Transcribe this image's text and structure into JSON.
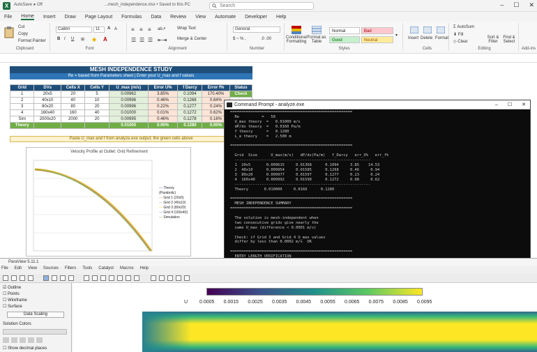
{
  "excel": {
    "title": "...mesh_independence.xlsx • Saved to this PC",
    "search_placeholder": "Search",
    "menu": [
      "File",
      "Home",
      "Insert",
      "Draw",
      "Page Layout",
      "Formulas",
      "Data",
      "Review",
      "View",
      "Automate",
      "Developer",
      "Help"
    ],
    "ribbon": {
      "clipboard": {
        "cut": "Cut",
        "copy": "Copy",
        "format_painter": "Format Painter",
        "label": "Clipboard"
      },
      "font": {
        "name": "Calibri",
        "size": "11",
        "label": "Font"
      },
      "alignment": {
        "wrap": "Wrap Text",
        "merge": "Merge & Center",
        "label": "Alignment"
      },
      "number": {
        "format": "General",
        "label": "Number"
      },
      "styles": {
        "conditional": "Conditional Formatting",
        "format_table": "Format as Table",
        "normal": "Normal",
        "bad": "Bad",
        "good": "Good",
        "neutral": "Neutral",
        "label": "Styles"
      },
      "cells": {
        "insert": "Insert",
        "delete": "Delete",
        "format": "Format",
        "label": "Cells"
      },
      "editing": {
        "autosum": "AutoSum",
        "fill": "Fill",
        "clear": "Clear",
        "sort": "Sort & Filter",
        "find": "Find & Select",
        "label": "Editing"
      },
      "addins": {
        "label": "Add-ins"
      }
    },
    "sheet": {
      "title": "MESH INDEPENDENCE STUDY",
      "subtitle": "Re = based from Parameters sheet  |  Enter your U_max and f values",
      "columns": [
        "Grid",
        "DVs",
        "Cells X",
        "Cells Y",
        "U_max (m/s)",
        "Error U%",
        "f Darcy",
        "Error f%",
        "Status"
      ],
      "rows": [
        [
          "1",
          "20x5",
          "20",
          "5",
          "0.00962",
          "3.85%",
          "0.1094",
          "170.40%",
          "Check"
        ],
        [
          "2",
          "40x10",
          "40",
          "10",
          "0.00996",
          "0.46%",
          "0.1268",
          "0.64%",
          ""
        ],
        [
          "3",
          "80x20",
          "80",
          "20",
          "0.00996",
          "0.22%",
          "0.1277",
          "0.24%",
          ""
        ],
        [
          "4",
          "160x40",
          "160",
          "40",
          "0.01000",
          "0.01%",
          "0.1272",
          "0.62%",
          ""
        ],
        [
          "Sim",
          "2000x20",
          "2000",
          "20",
          "0.00995",
          "0.46%",
          "0.1278",
          "0.16%",
          ""
        ],
        [
          "Theory",
          "",
          "",
          "",
          "0.01000",
          "0.00%",
          "0.1280",
          "0.00%",
          ""
        ]
      ],
      "note": "Paste U_max and f from analyze.exe output; the green cells above"
    },
    "chart": {
      "title": "Velocity Profile at Outlet: Grid Refinement",
      "legend": [
        "Theory (Parabolic)",
        "Grid 1 (20x5)",
        "Grid 2 (40x10)",
        "Grid 3 (80x20)",
        "Grid 4 (160x40)",
        "Simulation"
      ]
    }
  },
  "cmd": {
    "title": "Command Prompt - analyze.exe",
    "lines": [
      "======================================================",
      "  Re          =   50",
      "  U_max theory  =   0.01000 m/s",
      "  dP/dx theory  =   0.0160 Pa/m",
      "  f theory      =   0.1280",
      "  L_e theory    =   2.500 m",
      "",
      "======================================================",
      "",
      "  Grid  Size      U_max(m/s)   dP/dx(Pa/m)   f_Darcy   err_U%   err_f%",
      "  ------------------------------------------------------------",
      "  1  20x5       0.009615     0.01368      0.1094     3.85    14.53",
      "  2  40x10      0.009954     0.01585      0.1268     0.46     0.94",
      "  3  80x20      0.009977     0.01597      0.1277     0.23     0.24",
      "  4  160x40     0.009992     0.01590      0.1272     0.08     0.62",
      "  ------------------------------------------------------------",
      "  Theory       0.010000     0.0160      0.1280",
      "",
      "======================================================",
      "  MESH INDEPENDENCE SUMMARY",
      "======================================================",
      "",
      "  The solution is mesh-independent when",
      "  two consecutive grids give nearly the",
      "  same U_max (difference < 0.0001 m/s)",
      "",
      "  Check: if Grid 3 and Grid 4 U_max values",
      "  differ by less than 0.0002 m/s  OK",
      "",
      "======================================================",
      "  ENTRY LENGTH VERIFICATION"
    ]
  },
  "paraview": {
    "title": "ParaView 5.11.1",
    "menu": [
      "File",
      "Edit",
      "View",
      "Sources",
      "Filters",
      "Tools",
      "Catalyst",
      "Macros",
      "Help"
    ],
    "checks": [
      "Outline",
      "Points",
      "Wireframe",
      "Surface"
    ],
    "btn": "Data Scaling",
    "solution_label": "Solution Colors",
    "view": "Show decimal places",
    "colorbar": {
      "var": "U",
      "ticks": [
        "0.0005",
        "0.0015",
        "0.0025",
        "0.0035",
        "0.0045",
        "0.0055",
        "0.0065",
        "0.0075",
        "0.0085",
        "0.0095"
      ]
    }
  }
}
